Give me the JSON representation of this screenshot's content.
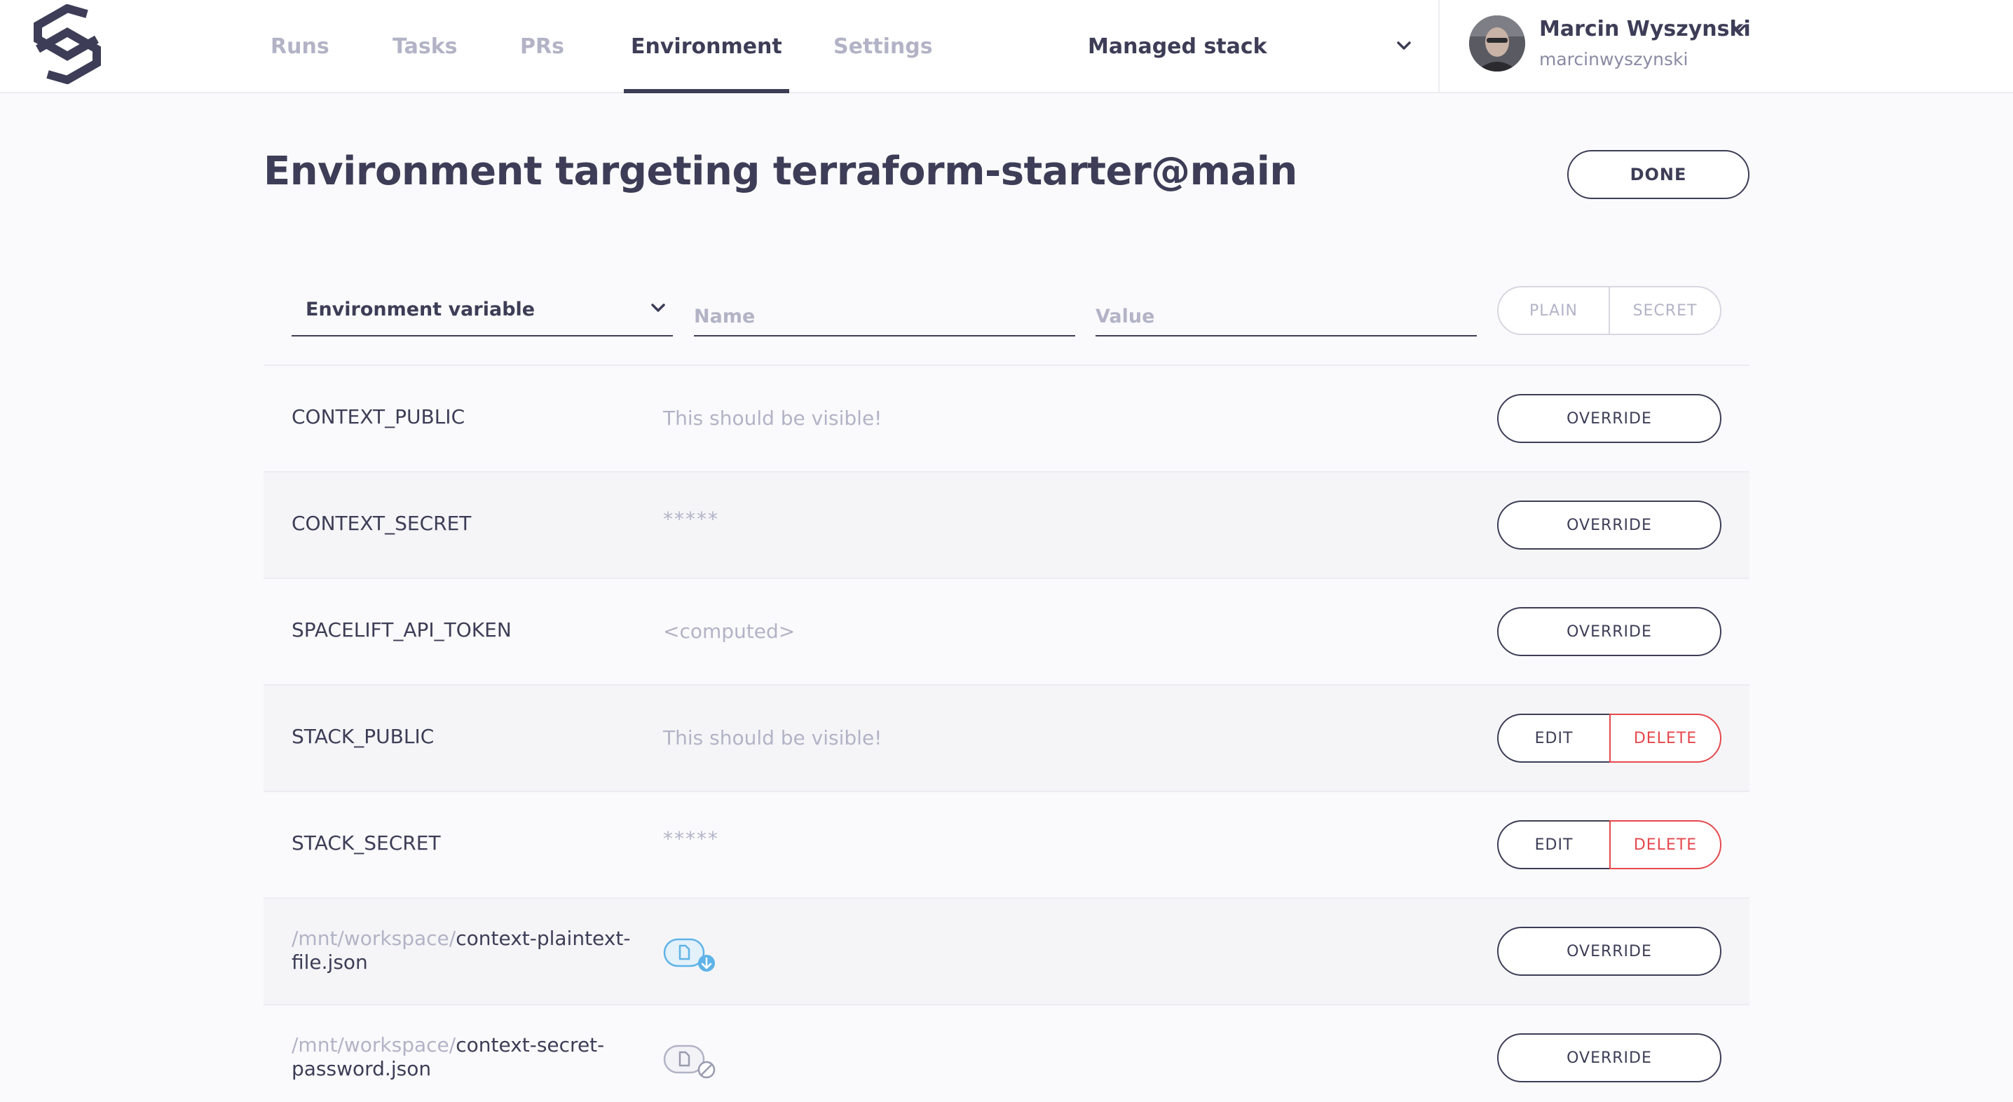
{
  "nav": {
    "tabs": [
      {
        "label": "Runs"
      },
      {
        "label": "Tasks"
      },
      {
        "label": "PRs"
      },
      {
        "label": "Environment",
        "active": true
      },
      {
        "label": "Settings"
      }
    ],
    "stack_selector": {
      "value": "Managed stack"
    }
  },
  "user": {
    "name": "Marcin Wyszynski",
    "login": "marcinwyszynski"
  },
  "page": {
    "title": "Environment targeting terraform-starter@main",
    "done_label": "DONE"
  },
  "form": {
    "type_value": "Environment variable",
    "name_placeholder": "Name",
    "value_placeholder": "Value",
    "plain_label": "PLAIN",
    "secret_label": "SECRET"
  },
  "rows": [
    {
      "name": "CONTEXT_PUBLIC",
      "value": "This should be visible!",
      "action": "OVERRIDE"
    },
    {
      "name": "CONTEXT_SECRET",
      "value": "*****",
      "action": "OVERRIDE"
    },
    {
      "name": "SPACELIFT_API_TOKEN",
      "value": "<computed>",
      "action": "OVERRIDE"
    },
    {
      "name": "STACK_PUBLIC",
      "value": "This should be visible!",
      "edit": "EDIT",
      "delete": "DELETE"
    },
    {
      "name": "STACK_SECRET",
      "value": "*****",
      "edit": "EDIT",
      "delete": "DELETE"
    },
    {
      "path_prefix": "/mnt/workspace/",
      "file": "context-plaintext-file.json",
      "icon": "file-download-icon",
      "action": "OVERRIDE"
    },
    {
      "path_prefix": "/mnt/workspace/",
      "file": "context-secret-password.json",
      "icon": "file-secret-icon",
      "action": "OVERRIDE"
    }
  ],
  "colors": {
    "primary": "#3d3d57",
    "muted": "#b3b3c7",
    "danger": "#e5484d",
    "accent": "#5fb3e8"
  }
}
